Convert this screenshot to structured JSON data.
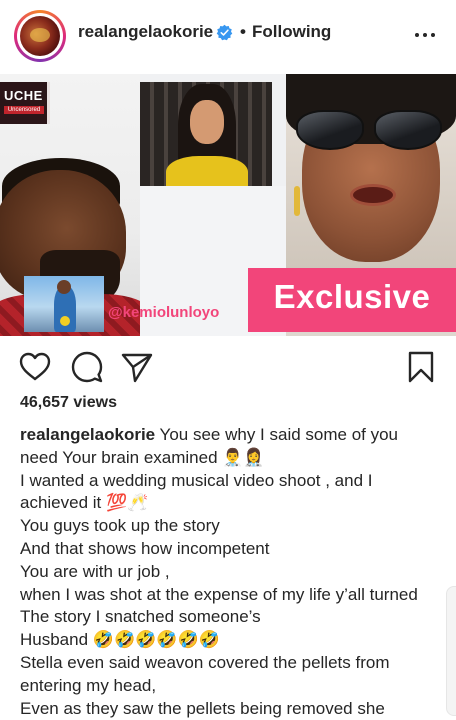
{
  "post": {
    "username": "realangelaokorie",
    "separator": "•",
    "follow_status": "Following",
    "views": "46,657 views"
  },
  "media": {
    "badge_title": "UCHE",
    "badge_subtitle": "Uncensored",
    "handle": "@kemiolunloyo",
    "banner": "Exclusive"
  },
  "caption": {
    "username": "realangelaokorie",
    "lines": [
      " You see why I said some of you",
      "need Your brain examined 👨‍⚕️👩‍⚕️",
      "I wanted a wedding musical video shoot , and I",
      "achieved it 💯🥂",
      "You guys took up the story",
      "And that shows how incompetent",
      "You are with ur job ,",
      "when I was shot at the expense of my life y’all turned",
      "The story I snatched someone’s",
      "Husband 🤣🤣🤣🤣🤣🤣",
      "Stella even said weavon covered the pellets from",
      "entering my head,",
      "Even as they saw the pellets being removed she"
    ]
  },
  "icons": {
    "avatar": "avatar",
    "verified": "verified-badge-icon",
    "more": "more-options-icon",
    "like": "heart-icon",
    "comment": "comment-icon",
    "share": "share-icon",
    "save": "bookmark-icon"
  },
  "colors": {
    "accent": "#f2457a",
    "verified": "#3897f0",
    "text": "#262626"
  }
}
